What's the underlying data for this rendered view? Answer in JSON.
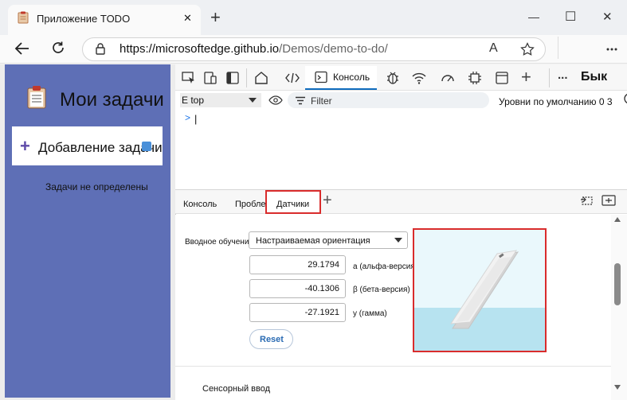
{
  "browser": {
    "tab_title": "Приложение TODO",
    "url_host": "https://microsoftedge.github.io",
    "url_path": "/Demos/demo-to-do/",
    "read_aloud": "A",
    "new_tab": "+",
    "minimize": "—",
    "maximize": "☐",
    "close": "✕"
  },
  "app": {
    "title": "Мои задачи",
    "add_task_label": "Добавление задачи",
    "add_icon": "+",
    "empty_text": "Задачи не определены"
  },
  "devtools": {
    "tabs": {
      "console": "Консоль",
      "more": "...",
      "quick": "Бык"
    },
    "filter_bar": {
      "context": "E top",
      "filter_placeholder": "Filter",
      "levels": "Уровни по умолчанию 0 3"
    },
    "console": {
      "prompt": ">",
      "caret": "|"
    },
    "drawer": {
      "tabs": [
        "Консоль",
        "Проблемы",
        "Датчики"
      ],
      "add": "+"
    },
    "sensors": {
      "orientation_label": "Вводное обучение",
      "orientation_value": "Настраиваемая ориентация",
      "alpha": {
        "value": "29.1794",
        "label": "а (альфа-версия)"
      },
      "beta": {
        "value": "-40.1306",
        "label": "β (бета-версия)"
      },
      "gamma": {
        "value": "-27.1921",
        "label": "у (гамма)"
      },
      "reset_label": "Reset",
      "touch_label": "Сенсорный ввод"
    }
  },
  "colors": {
    "app_bg": "#5e6fb6",
    "highlight": "#d92c2c",
    "accent": "#0f6cbd"
  }
}
